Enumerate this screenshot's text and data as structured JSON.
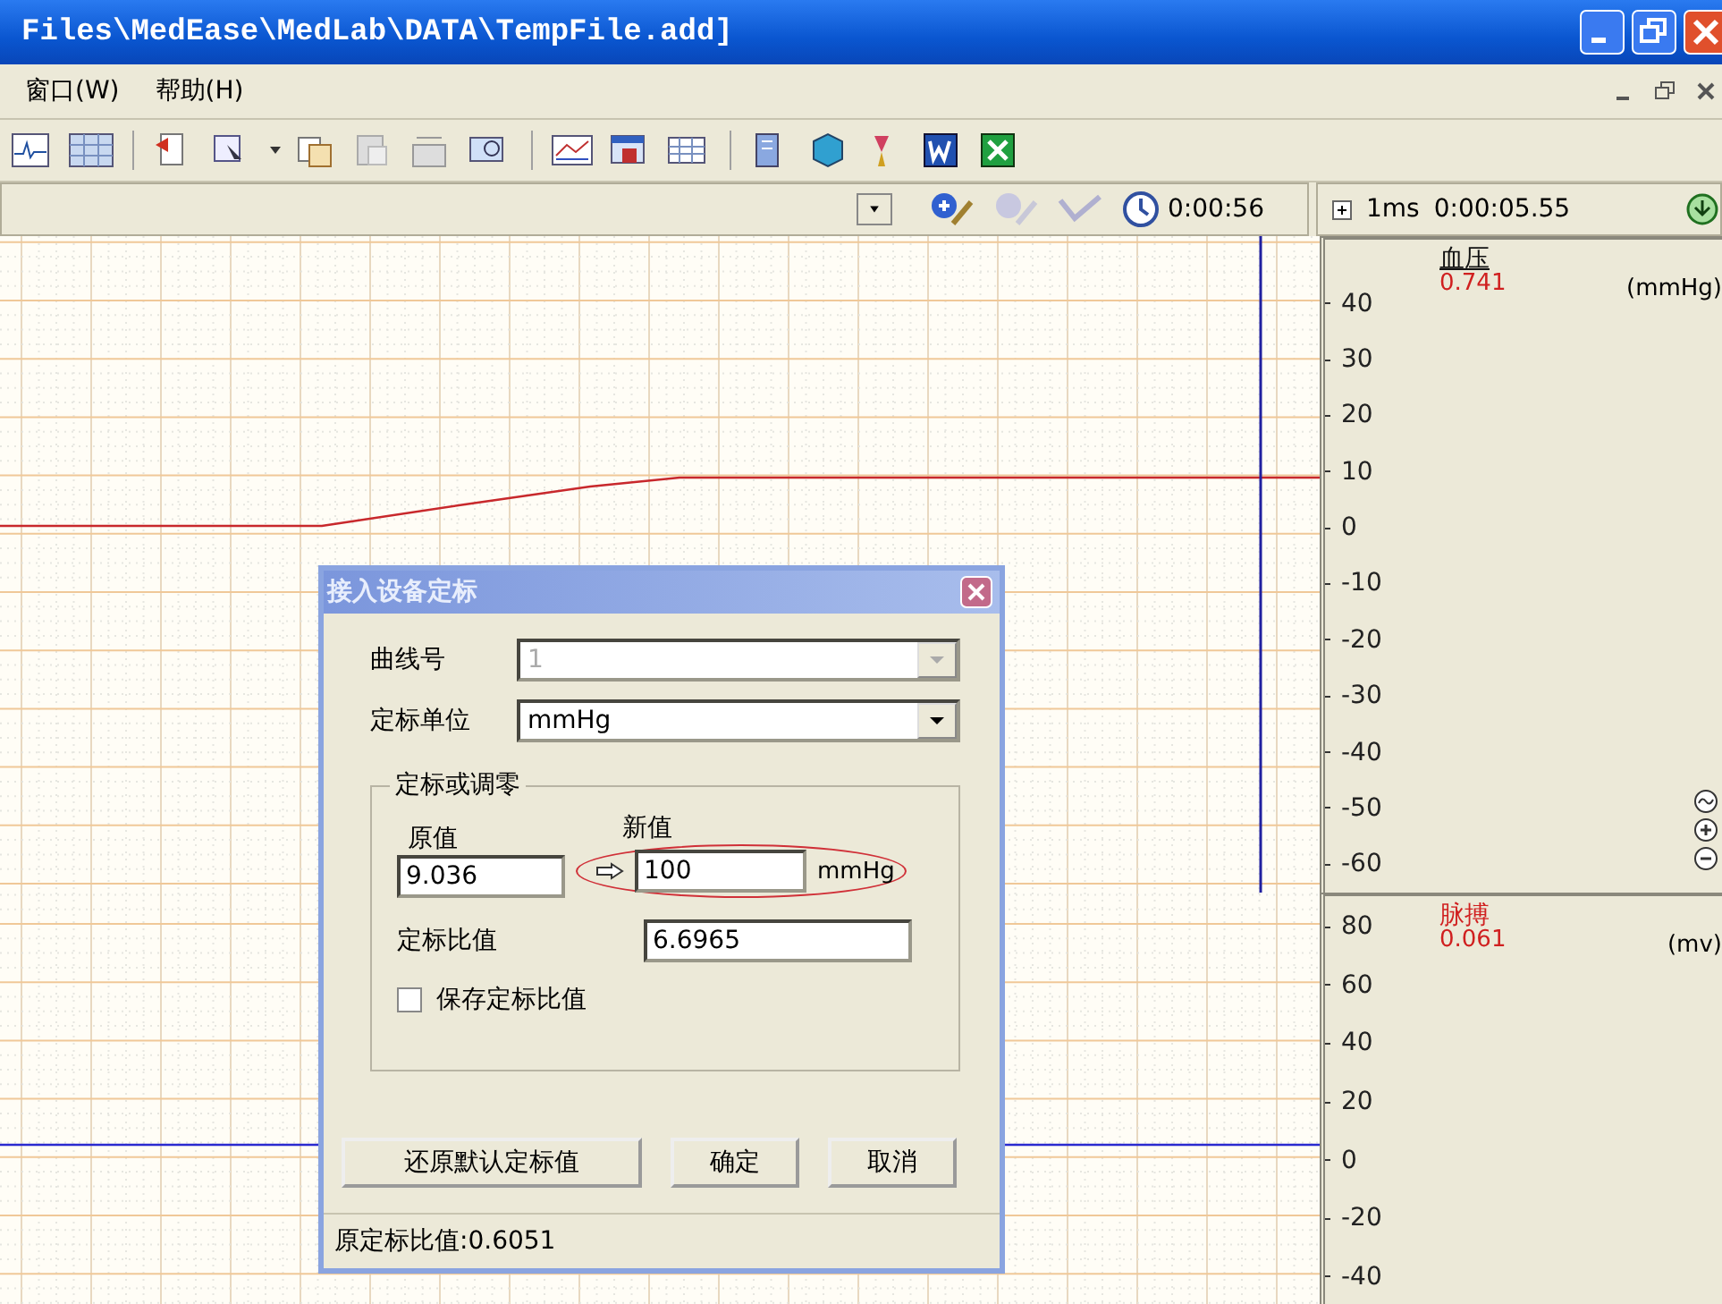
{
  "window": {
    "title": "Files\\MedEase\\MedLab\\DATA\\TempFile.add]"
  },
  "menu": [
    "窗口(W)",
    "帮助(H)"
  ],
  "record_bar": {
    "elapsed": "0:00:56"
  },
  "time_panel": {
    "scale": "1ms",
    "time": "0:00:05.55"
  },
  "channels": [
    {
      "name": "血压",
      "value": "0.741",
      "unit": "(mmHg)",
      "selected": true,
      "cursor": true,
      "color": "#c8282c",
      "ticks": [
        "40",
        "30",
        "20",
        "10",
        "0",
        "-10",
        "-20",
        "-30",
        "-40",
        "-50",
        "-60"
      ]
    },
    {
      "name": "脉搏",
      "value": "0.061",
      "unit": "(mv)",
      "selected": false,
      "cursor": false,
      "color": "#2a2ad0",
      "ticks": [
        "80",
        "60",
        "40",
        "20",
        "0",
        "-20",
        "-40"
      ]
    }
  ],
  "dialog": {
    "title": "接入设备定标",
    "curve": {
      "label": "曲线号",
      "value": "1",
      "disabled": true
    },
    "unit": {
      "label": "定标单位",
      "value": "mmHg",
      "disabled": false
    },
    "group": {
      "title": "定标或调零",
      "original": {
        "label": "原值",
        "value": "9.036"
      },
      "new": {
        "label": "新值",
        "value": "100",
        "unit": "mmHg",
        "highlighted": true
      },
      "ratio": {
        "label": "定标比值",
        "value": "6.6965"
      },
      "save": {
        "label": "保存定标比值",
        "checked": false
      }
    },
    "buttons": [
      "还原默认定标值",
      "确定",
      "取消"
    ],
    "status": "原定标比值:0.6051"
  }
}
